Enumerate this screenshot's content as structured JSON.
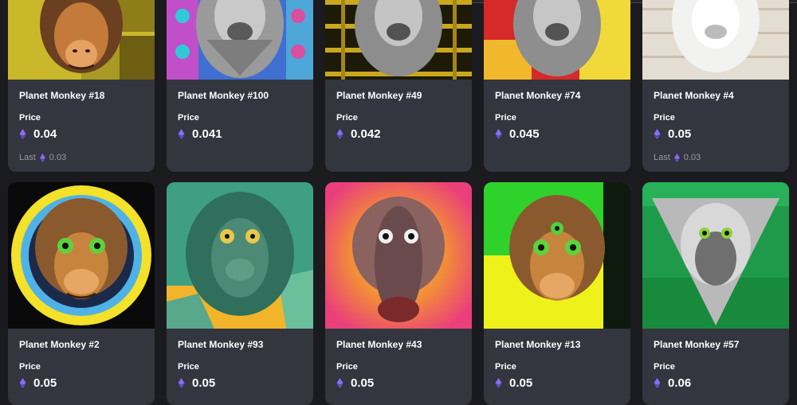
{
  "nft_grid": {
    "row1": [
      {
        "name": "Planet Monkey #18",
        "price_label": "Price",
        "price": "0.04",
        "last_label": "Last",
        "last_price": "0.03"
      },
      {
        "name": "Planet Monkey #100",
        "price_label": "Price",
        "price": "0.041"
      },
      {
        "name": "Planet Monkey #49",
        "price_label": "Price",
        "price": "0.042"
      },
      {
        "name": "Planet Monkey #74",
        "price_label": "Price",
        "price": "0.045"
      },
      {
        "name": "Planet Monkey #4",
        "price_label": "Price",
        "price": "0.05",
        "last_label": "Last",
        "last_price": "0.03"
      }
    ],
    "row2": [
      {
        "name": "Planet Monkey #2",
        "price_label": "Price",
        "price": "0.05"
      },
      {
        "name": "Planet Monkey #93",
        "price_label": "Price",
        "price": "0.05"
      },
      {
        "name": "Planet Monkey #43",
        "price_label": "Price",
        "price": "0.05"
      },
      {
        "name": "Planet Monkey #13",
        "price_label": "Price",
        "price": "0.05"
      },
      {
        "name": "Planet Monkey #57",
        "price_label": "Price",
        "price": "0.06"
      }
    ]
  },
  "colors": {
    "page_bg": "#1b1b1f",
    "card_bg": "#33353f",
    "eth_icon": "#8a6cf5",
    "muted_text": "#9a9aa5"
  },
  "icons": {
    "currency": "ethereum-icon"
  }
}
